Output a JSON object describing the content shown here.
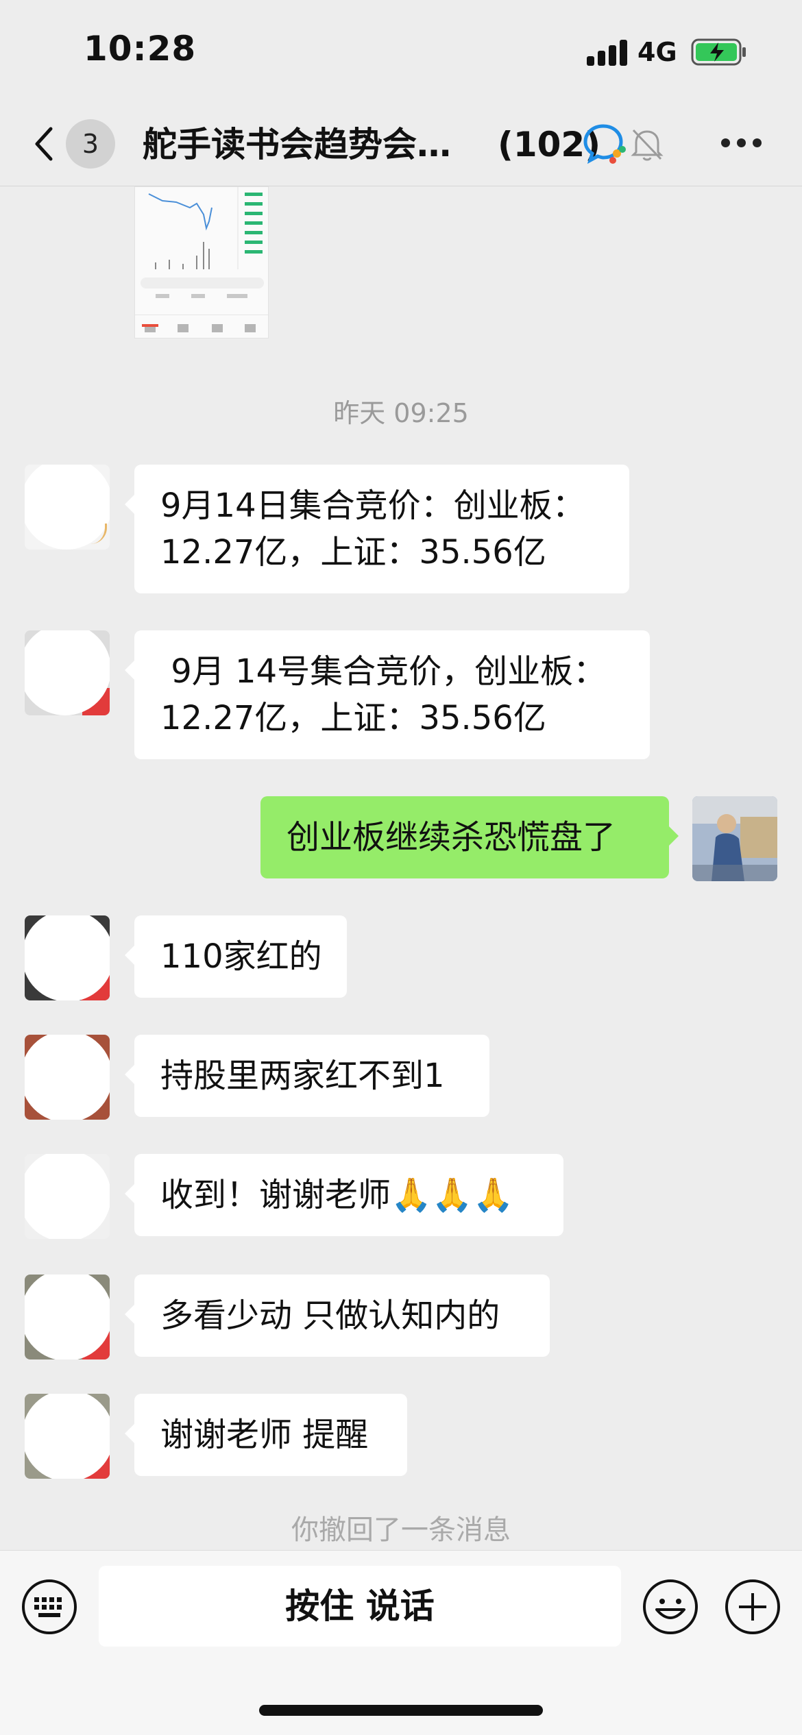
{
  "status_bar": {
    "time": "10:28",
    "network": "4G"
  },
  "header": {
    "unread_count": "3",
    "title": "舵手读书会趋势会…",
    "member_count": "(102)"
  },
  "timestamp": "昨天 09:25",
  "messages": [
    {
      "side": "in",
      "lines": [
        "9月14日集合竞价：创业板：",
        "12.27亿，上证：35.56亿"
      ]
    },
    {
      "side": "in",
      "lines": [
        " 9月 14号集合竞价，创业板：",
        "12.27亿，上证：35.56亿"
      ]
    },
    {
      "side": "out",
      "lines": [
        "创业板继续杀恐慌盘了"
      ]
    },
    {
      "side": "in",
      "lines": [
        "110家红的"
      ]
    },
    {
      "side": "in",
      "lines": [
        "持股里两家红不到1"
      ]
    },
    {
      "side": "in",
      "lines": [
        "收到！谢谢老师🙏🙏🙏"
      ]
    },
    {
      "side": "in",
      "lines": [
        "多看少动 只做认知内的"
      ]
    },
    {
      "side": "in",
      "lines": [
        "谢谢老师 提醒"
      ]
    }
  ],
  "recall_notice": "你撤回了一条消息",
  "input_bar": {
    "hold_to_talk": "按住 说话"
  },
  "colors": {
    "background": "#ededed",
    "outgoing_bubble": "#95ec69",
    "incoming_bubble": "#ffffff"
  }
}
